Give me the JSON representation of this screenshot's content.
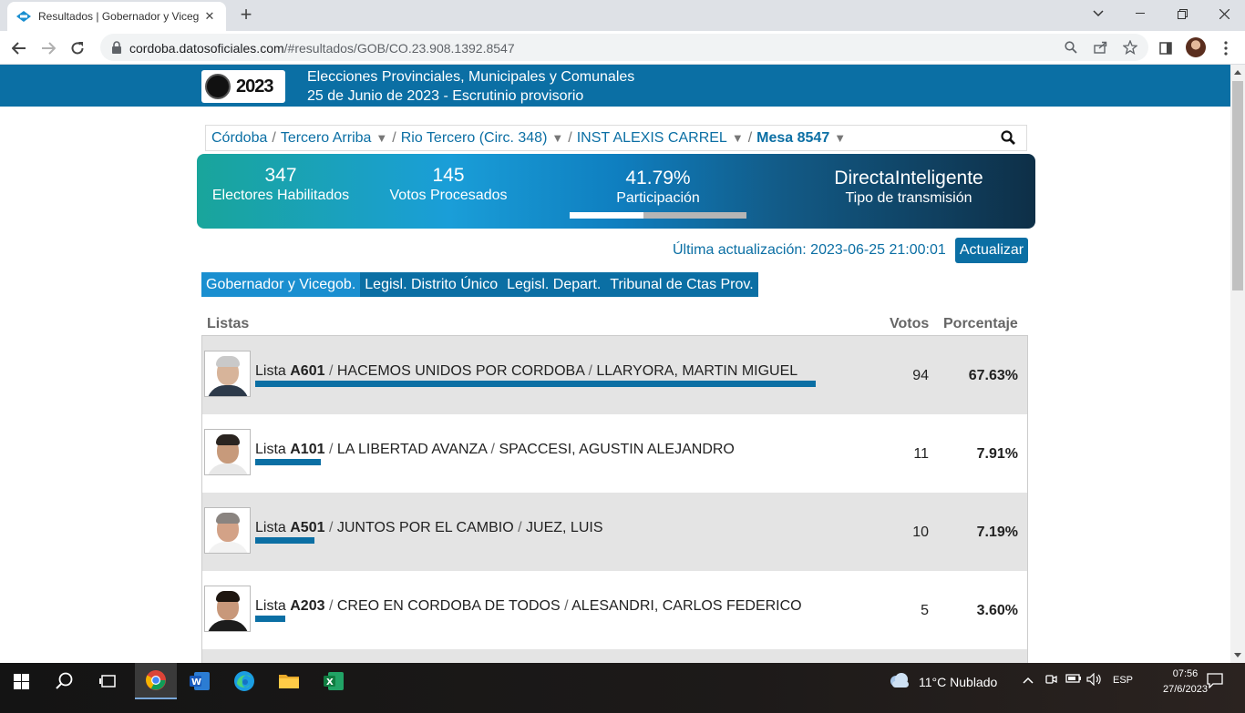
{
  "browser": {
    "tab_title": "Resultados | Gobernador y Viceg",
    "new_tab": "+",
    "url_host": "cordoba.datosoficiales.com",
    "url_path": "/#resultados/GOB/CO.23.908.1392.8547"
  },
  "header": {
    "logo_text": "2023",
    "line1": "Elecciones Provinciales, Municipales y Comunales",
    "line2": "25 de Junio de 2023 - Escrutinio provisorio"
  },
  "breadcrumb": {
    "items": [
      "Córdoba",
      "Tercero Arriba",
      "Rio Tercero (Circ. 348)",
      "INST ALEXIS CARREL",
      "Mesa 8547"
    ],
    "separator": "/",
    "caret": "▼"
  },
  "stats": {
    "electores_value": "347",
    "electores_label": "Electores Habilitados",
    "votos_value": "145",
    "votos_label": "Votos Procesados",
    "participacion_value": "41.79%",
    "participacion_label": "Participación",
    "participacion_fraction": 0.4179,
    "transmision_value": "DirectaInteligente",
    "transmision_label": "Tipo de transmisión"
  },
  "update": {
    "last_update": "Última actualización: 2023-06-25 21:00:01",
    "button": "Actualizar"
  },
  "election_tabs": [
    "Gobernador y Vicegob.",
    "Legisl. Distrito Único",
    "Legisl. Depart.",
    "Tribunal de Ctas Prov."
  ],
  "table": {
    "col_listas": "Listas",
    "col_votos": "Votos",
    "col_porcentaje": "Porcentaje",
    "lista_prefix": "Lista",
    "rows": [
      {
        "code": "A601",
        "party": "HACEMOS UNIDOS POR CORDOBA",
        "candidate": "LLARYORA, MARTIN MIGUEL",
        "votes": "94",
        "percent": "67.63%",
        "fraction": 0.6763
      },
      {
        "code": "A101",
        "party": "LA LIBERTAD AVANZA",
        "candidate": "SPACCESI, AGUSTIN ALEJANDRO",
        "votes": "11",
        "percent": "7.91%",
        "fraction": 0.0791
      },
      {
        "code": "A501",
        "party": "JUNTOS POR EL CAMBIO",
        "candidate": "JUEZ, LUIS",
        "votes": "10",
        "percent": "7.19%",
        "fraction": 0.0719
      },
      {
        "code": "A203",
        "party": "CREO EN CORDOBA DE TODOS",
        "candidate": "ALESANDRI, CARLOS FEDERICO",
        "votes": "5",
        "percent": "3.60%",
        "fraction": 0.036
      }
    ]
  },
  "taskbar": {
    "weather": "11°C  Nublado",
    "lang": "ESP",
    "time": "07:56",
    "date": "27/6/2023"
  },
  "colors": {
    "brand": "#0b6fa4",
    "active_tab": "#1a8fd0"
  }
}
